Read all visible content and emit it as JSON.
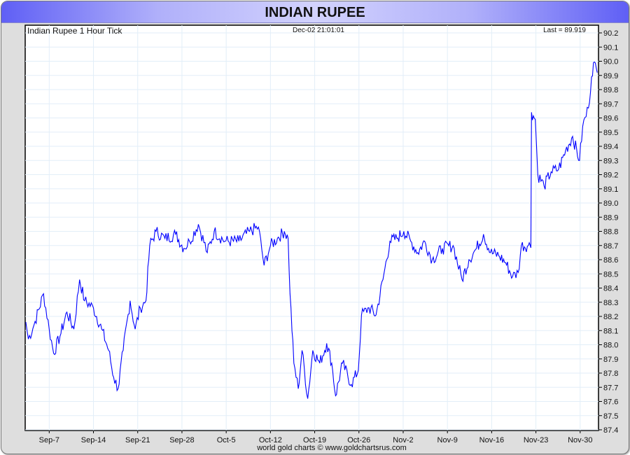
{
  "title": "INDIAN RUPEE",
  "footer": "world gold charts © www.goldchartsrus.com",
  "chart_data": {
    "type": "line",
    "title": "Indian Rupee 1 Hour Tick",
    "timestamp": "Dec-02  21:01:01",
    "last_label": "Last = 89.919",
    "x_unit": "days after Sep-7",
    "xlim": [
      -3.8,
      86.9
    ],
    "ylim": [
      87.4,
      90.25
    ],
    "x_ticks": [
      {
        "x": 0,
        "label": "Sep-7"
      },
      {
        "x": 7,
        "label": "Sep-14"
      },
      {
        "x": 14,
        "label": "Sep-21"
      },
      {
        "x": 21,
        "label": "Sep-28"
      },
      {
        "x": 28,
        "label": "Oct-5"
      },
      {
        "x": 35,
        "label": "Oct-12"
      },
      {
        "x": 42,
        "label": "Oct-19"
      },
      {
        "x": 49,
        "label": "Oct-26"
      },
      {
        "x": 56,
        "label": "Nov-2"
      },
      {
        "x": 63,
        "label": "Nov-9"
      },
      {
        "x": 70,
        "label": "Nov-16"
      },
      {
        "x": 77,
        "label": "Nov-23"
      },
      {
        "x": 84,
        "label": "Nov-30"
      }
    ],
    "y_ticks": [
      "87.4",
      "87.5",
      "87.6",
      "87.7",
      "87.8",
      "87.9",
      "88.0",
      "88.1",
      "88.2",
      "88.3",
      "88.4",
      "88.5",
      "88.6",
      "88.7",
      "88.8",
      "88.9",
      "89.0",
      "89.1",
      "89.2",
      "89.3",
      "89.4",
      "89.5",
      "89.6",
      "89.7",
      "89.8",
      "89.9",
      "90.0",
      "90.1",
      "90.2"
    ],
    "grid": true,
    "series": [
      {
        "name": "Indian Rupee",
        "color": "#0000ff",
        "x": [
          -3.7,
          -3.3,
          -2.4,
          -0.9,
          0,
          0.7,
          1.7,
          2.8,
          3.9,
          4.8,
          5.6,
          7.0,
          8.3,
          9.4,
          10.2,
          10.9,
          11.7,
          12.8,
          13.6,
          14.4,
          15.3,
          15.9,
          16.9,
          18.3,
          20.0,
          21.3,
          22.2,
          23.6,
          25.0,
          26.1,
          27.8,
          30.0,
          31.7,
          33.1,
          34.0,
          35.0,
          36.1,
          37.2,
          37.8,
          38.1,
          38.7,
          39.4,
          40.0,
          40.9,
          41.7,
          42.8,
          43.9,
          44.7,
          45.3,
          46.4,
          47.8,
          48.9,
          49.4,
          50.6,
          51.7,
          52.8,
          53.9,
          55.0,
          56.1,
          57.2,
          58.3,
          59.4,
          60.6,
          62.2,
          63.9,
          65.3,
          66.4,
          67.6,
          68.7,
          69.8,
          71.1,
          72.2,
          73.3,
          74.2,
          74.7,
          75.8,
          76.1,
          76.3,
          76.9,
          77.3,
          78.3,
          79.4,
          80.6,
          81.7,
          82.8,
          83.9,
          84.4,
          85.3,
          85.8,
          86.1,
          86.7
        ],
        "values": [
          88.16,
          88.04,
          88.14,
          88.36,
          88.11,
          87.94,
          88.06,
          88.23,
          88.11,
          88.46,
          88.31,
          88.26,
          88.11,
          87.96,
          87.77,
          87.69,
          87.96,
          88.31,
          88.11,
          88.26,
          88.31,
          88.7,
          88.8,
          88.75,
          88.78,
          88.68,
          88.73,
          88.85,
          88.65,
          88.8,
          88.73,
          88.73,
          88.8,
          88.83,
          88.56,
          88.7,
          88.75,
          88.8,
          88.75,
          88.36,
          87.87,
          87.69,
          87.96,
          87.62,
          87.96,
          87.87,
          88.01,
          87.87,
          87.64,
          87.87,
          87.72,
          87.82,
          88.21,
          88.26,
          88.21,
          88.46,
          88.73,
          88.75,
          88.8,
          88.73,
          88.65,
          88.73,
          88.6,
          88.68,
          88.7,
          88.46,
          88.6,
          88.68,
          88.78,
          88.65,
          88.63,
          88.58,
          88.48,
          88.51,
          88.7,
          88.7,
          88.7,
          89.64,
          89.59,
          89.2,
          89.12,
          89.22,
          89.24,
          89.37,
          89.47,
          89.3,
          89.54,
          89.67,
          89.89,
          89.99,
          89.92
        ]
      }
    ]
  }
}
